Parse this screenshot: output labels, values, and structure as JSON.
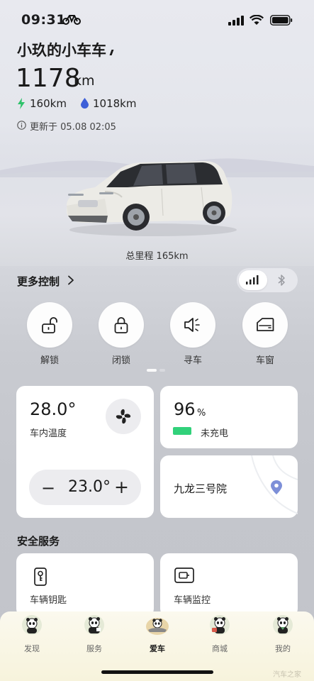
{
  "status_bar": {
    "time": "09:31"
  },
  "header": {
    "car_name": "小玖的小车车",
    "range_value": "1178",
    "range_unit": "km",
    "electric_range": "160km",
    "fuel_range": "1018km",
    "update_text": "更新于 05.08 02:05"
  },
  "hero": {
    "mileage": "总里程 165km"
  },
  "controls": {
    "more_label": "更多控制",
    "quick": [
      {
        "label": "解锁",
        "icon": "unlock-icon"
      },
      {
        "label": "闭锁",
        "icon": "lock-icon"
      },
      {
        "label": "寻车",
        "icon": "speaker-icon"
      },
      {
        "label": "车窗",
        "icon": "window-icon"
      }
    ]
  },
  "climate": {
    "inside_temp": "28.0°",
    "inside_label": "车内温度",
    "setpoint": "23.0°",
    "minus": "−",
    "plus": "+"
  },
  "battery": {
    "percent": "96",
    "percent_unit": "%",
    "charge_status": "未充电",
    "level": 0.96,
    "color": "#31d17a"
  },
  "location": {
    "name": "九龙三号院"
  },
  "safety": {
    "title": "安全服务",
    "key_label": "车辆钥匙",
    "monitor_label": "车辆监控"
  },
  "tabs": [
    {
      "label": "发现",
      "active": false
    },
    {
      "label": "服务",
      "active": false
    },
    {
      "label": "爱车",
      "active": true
    },
    {
      "label": "商城",
      "active": false
    },
    {
      "label": "我的",
      "active": false
    }
  ],
  "watermark": "汽车之家"
}
